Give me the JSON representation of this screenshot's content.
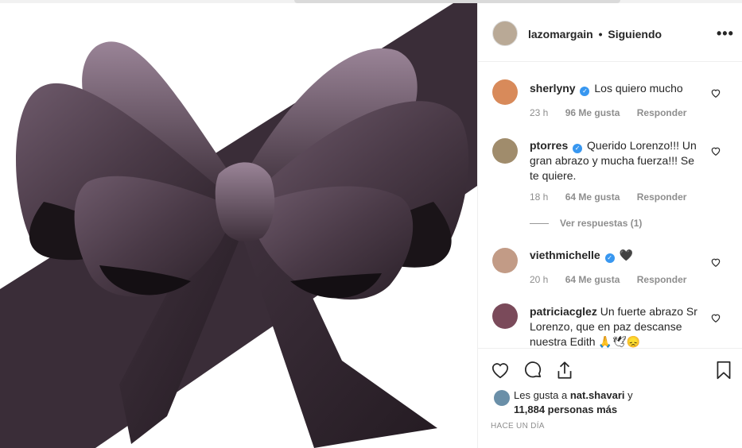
{
  "post": {
    "author": "lazomargain",
    "separator": "•",
    "follow_status": "Siguiendo",
    "more_icon": "ellipsis-icon"
  },
  "comments": [
    {
      "username": "sherlyny",
      "verified": true,
      "text": "Los quiero mucho",
      "time": "23 h",
      "likes": "96 Me gusta",
      "reply": "Responder"
    },
    {
      "username": "ptorres",
      "verified": true,
      "text": "Querido Lorenzo!!! Un gran abrazo y mucha fuerza!!! Se te quiere.",
      "time": "18 h",
      "likes": "64 Me gusta",
      "reply": "Responder",
      "view_replies": "Ver respuestas (1)"
    },
    {
      "username": "viethmichelle",
      "verified": true,
      "text": "🖤",
      "time": "20 h",
      "likes": "64 Me gusta",
      "reply": "Responder"
    },
    {
      "username": "patriciacglez",
      "verified": false,
      "text": "Un fuerte abrazo Sr Lorenzo, que en paz descanse nuestra Edith 🙏🕊😞"
    }
  ],
  "likes_summary": {
    "prefix": "Les gusta a",
    "user": "nat.shavari",
    "connector": "y",
    "others": "11,884 personas más"
  },
  "timestamp": "HACE UN DÍA",
  "colors": {
    "ribbon": "#3b2e38",
    "ribbon_highlight": "#8a7487",
    "verified": "#3897f0"
  }
}
